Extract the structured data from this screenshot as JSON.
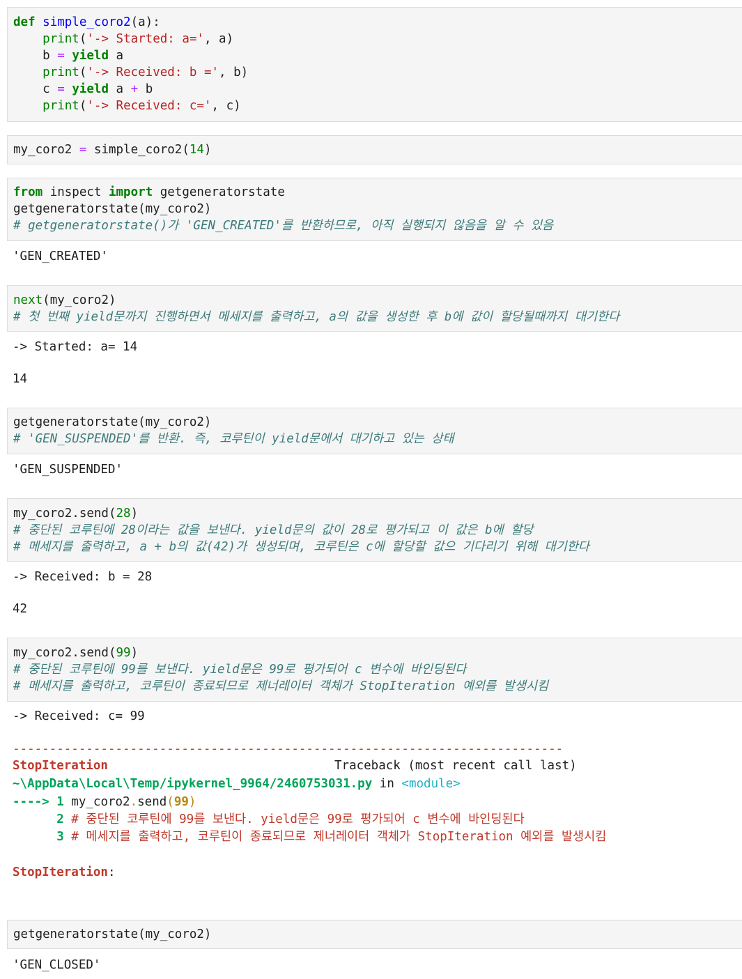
{
  "cell1": {
    "lines": [
      {
        "kw": "def",
        "sp": " ",
        "fn": "simple_coro2",
        "rest": "(a):"
      },
      {
        "ind": "    ",
        "bi": "print",
        "p1": "(",
        "str": "'-> Started: a='",
        "rest": ", a)"
      },
      {
        "ind": "    ",
        "a": "b ",
        "op": "=",
        "sp": " ",
        "kw": "yield",
        "rest": " a"
      },
      {
        "ind": "    ",
        "bi": "print",
        "p1": "(",
        "str": "'-> Received: b ='",
        "rest": ", b)"
      },
      {
        "ind": "    ",
        "a": "c ",
        "op": "=",
        "sp": " ",
        "kw": "yield",
        "rest": " a ",
        "op2": "+",
        "rest2": " b"
      },
      {
        "ind": "    ",
        "bi": "print",
        "p1": "(",
        "str": "'-> Received: c='",
        "rest": ", c)"
      }
    ]
  },
  "cell2": {
    "a": "my_coro2 ",
    "op": "=",
    "b": " simple_coro2(",
    "num": "14",
    "c": ")"
  },
  "cell3": {
    "kw1": "from",
    "mod": " inspect ",
    "kw2": "import",
    "name": " getgeneratorstate",
    "call": "getgeneratorstate(my_coro2)",
    "comment": "# getgeneratorstate()가 'GEN_CREATED'를 반환하므로, 아직 실행되지 않음을 알 수 있음",
    "output": "'GEN_CREATED'"
  },
  "cell4": {
    "bi": "next",
    "rest": "(my_coro2)",
    "comment": "# 첫 번째 yield문까지 진행하면서 메세지를 출력하고, a의 값을 생성한 후 b에 값이 할당될때까지 대기한다",
    "stdout": "-> Started: a= 14",
    "output": "14"
  },
  "cell5": {
    "call": "getgeneratorstate(my_coro2)",
    "comment": "# 'GEN_SUSPENDED'를 반환. 즉, 코루틴이 yield문에서 대기하고 있는 상태",
    "output": "'GEN_SUSPENDED'"
  },
  "cell6": {
    "a": "my_coro2.send(",
    "num": "28",
    "b": ")",
    "comment1": "# 중단된 코루틴에 28이라는 값을 보낸다. yield문의 값이 28로 평가되고 이 값은 b에 할당",
    "comment2": "# 메세지를 출력하고, a + b의 값(42)가 생성되며, 코루틴은 c에 할당할 값으 기다리기 위해 대기한다",
    "stdout": "-> Received: b = 28",
    "output": "42"
  },
  "cell7": {
    "a": "my_coro2.send(",
    "num": "99",
    "b": ")",
    "comment1": "# 중단된 코루틴에 99를 보낸다. yield문은 99로 평가되어 c 변수에 바인딩된다",
    "comment2": "# 메세지를 출력하고, 코루틴이 종료되므로 제너레이터 객체가 StopIteration 예외를 발생시킴",
    "stdout": "-> Received: c= 99",
    "traceback": {
      "dashes": "---------------------------------------------------------------------------",
      "exc": "StopIteration",
      "header": "Traceback (most recent call last)",
      "path": "~\\AppData\\Local\\Temp/ipykernel_9964/2460753031.py",
      "in": " in ",
      "module": "<module>",
      "arrow": "----> 1",
      "l1a": " my_coro2",
      "l1dot": ".",
      "l1b": "send",
      "l1p": "(",
      "l1num": "99",
      "l1c": ")",
      "n2": "      2",
      "l2": " # 중단된 코루틴에 99를 보낸다. yield문은 99로 평가되어 c 변수에 바인딩된다",
      "n3": "      3",
      "l3": " # 메세지를 출력하고, 코루틴이 종료되므로 제너레이터 객체가 StopIteration 예외를 발생시킴",
      "final": "StopIteration",
      "colon": ":"
    }
  },
  "cell8": {
    "call": "getgeneratorstate(my_coro2)",
    "output": "'GEN_CLOSED'"
  }
}
